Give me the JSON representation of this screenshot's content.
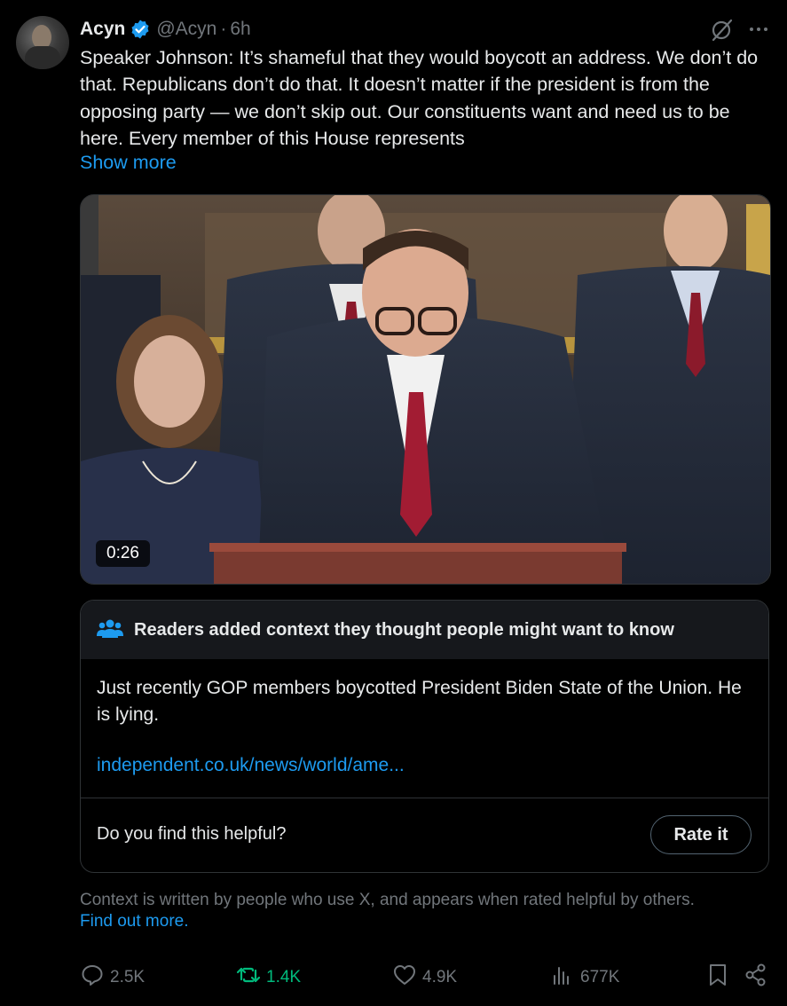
{
  "tweet": {
    "author_name": "Acyn",
    "handle": "@Acyn",
    "separator": "·",
    "time": "6h",
    "text": "Speaker Johnson: It’s shameful that they would boycott an address. We don’t do that. Republicans don’t do that. It doesn’t matter if the president is from the opposing party — we don’t skip out. Our constituents want and need us to be here. Every member of this House represents",
    "show_more": "Show more"
  },
  "media": {
    "duration": "0:26"
  },
  "community_note": {
    "header": "Readers added context they thought people might want to know",
    "body": "Just recently GOP members boycotted President Biden State of the Union. He is lying.",
    "link": "independent.co.uk/news/world/ame...",
    "helpful_question": "Do you find this helpful?",
    "rate_button": "Rate it"
  },
  "context_info": {
    "text": "Context is written by people who use X, and appears when rated helpful by others.",
    "link": "Find out more."
  },
  "actions": {
    "replies": "2.5K",
    "reposts": "1.4K",
    "likes": "4.9K",
    "views": "677K"
  },
  "colors": {
    "accent": "#1d9bf0",
    "repost_active": "#00ba7c",
    "muted": "#71767b",
    "text": "#e7e9ea"
  },
  "icons": [
    "verified-badge-icon",
    "grok-icon",
    "more-icon",
    "community-notes-icon",
    "reply-icon",
    "repost-icon",
    "like-icon",
    "views-icon",
    "bookmark-icon",
    "share-icon"
  ]
}
